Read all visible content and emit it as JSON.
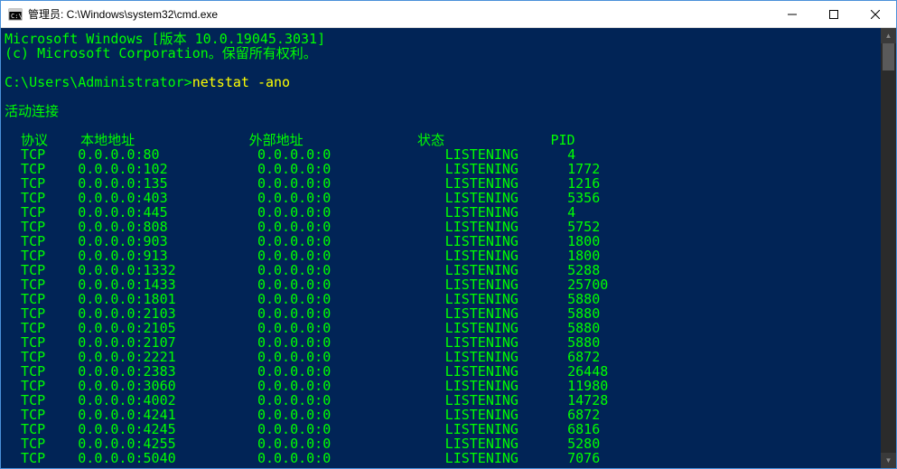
{
  "titlebar": {
    "text": "管理员: C:\\Windows\\system32\\cmd.exe"
  },
  "banner": {
    "line1": "Microsoft Windows [版本 10.0.19045.3031]",
    "line2": "(c) Microsoft Corporation。保留所有权利。"
  },
  "prompt": {
    "path": "C:\\Users\\Administrator>",
    "command": "netstat -ano"
  },
  "section_header": "活动连接",
  "columns": {
    "proto": "协议",
    "local": "本地地址",
    "foreign": "外部地址",
    "state": "状态",
    "pid": "PID"
  },
  "rows": [
    {
      "proto": "TCP",
      "local": "0.0.0.0:80",
      "foreign": "0.0.0.0:0",
      "state": "LISTENING",
      "pid": "4"
    },
    {
      "proto": "TCP",
      "local": "0.0.0.0:102",
      "foreign": "0.0.0.0:0",
      "state": "LISTENING",
      "pid": "1772"
    },
    {
      "proto": "TCP",
      "local": "0.0.0.0:135",
      "foreign": "0.0.0.0:0",
      "state": "LISTENING",
      "pid": "1216"
    },
    {
      "proto": "TCP",
      "local": "0.0.0.0:403",
      "foreign": "0.0.0.0:0",
      "state": "LISTENING",
      "pid": "5356"
    },
    {
      "proto": "TCP",
      "local": "0.0.0.0:445",
      "foreign": "0.0.0.0:0",
      "state": "LISTENING",
      "pid": "4"
    },
    {
      "proto": "TCP",
      "local": "0.0.0.0:808",
      "foreign": "0.0.0.0:0",
      "state": "LISTENING",
      "pid": "5752"
    },
    {
      "proto": "TCP",
      "local": "0.0.0.0:903",
      "foreign": "0.0.0.0:0",
      "state": "LISTENING",
      "pid": "1800"
    },
    {
      "proto": "TCP",
      "local": "0.0.0.0:913",
      "foreign": "0.0.0.0:0",
      "state": "LISTENING",
      "pid": "1800"
    },
    {
      "proto": "TCP",
      "local": "0.0.0.0:1332",
      "foreign": "0.0.0.0:0",
      "state": "LISTENING",
      "pid": "5288"
    },
    {
      "proto": "TCP",
      "local": "0.0.0.0:1433",
      "foreign": "0.0.0.0:0",
      "state": "LISTENING",
      "pid": "25700"
    },
    {
      "proto": "TCP",
      "local": "0.0.0.0:1801",
      "foreign": "0.0.0.0:0",
      "state": "LISTENING",
      "pid": "5880"
    },
    {
      "proto": "TCP",
      "local": "0.0.0.0:2103",
      "foreign": "0.0.0.0:0",
      "state": "LISTENING",
      "pid": "5880"
    },
    {
      "proto": "TCP",
      "local": "0.0.0.0:2105",
      "foreign": "0.0.0.0:0",
      "state": "LISTENING",
      "pid": "5880"
    },
    {
      "proto": "TCP",
      "local": "0.0.0.0:2107",
      "foreign": "0.0.0.0:0",
      "state": "LISTENING",
      "pid": "5880"
    },
    {
      "proto": "TCP",
      "local": "0.0.0.0:2221",
      "foreign": "0.0.0.0:0",
      "state": "LISTENING",
      "pid": "6872"
    },
    {
      "proto": "TCP",
      "local": "0.0.0.0:2383",
      "foreign": "0.0.0.0:0",
      "state": "LISTENING",
      "pid": "26448"
    },
    {
      "proto": "TCP",
      "local": "0.0.0.0:3060",
      "foreign": "0.0.0.0:0",
      "state": "LISTENING",
      "pid": "11980"
    },
    {
      "proto": "TCP",
      "local": "0.0.0.0:4002",
      "foreign": "0.0.0.0:0",
      "state": "LISTENING",
      "pid": "14728"
    },
    {
      "proto": "TCP",
      "local": "0.0.0.0:4241",
      "foreign": "0.0.0.0:0",
      "state": "LISTENING",
      "pid": "6872"
    },
    {
      "proto": "TCP",
      "local": "0.0.0.0:4245",
      "foreign": "0.0.0.0:0",
      "state": "LISTENING",
      "pid": "6816"
    },
    {
      "proto": "TCP",
      "local": "0.0.0.0:4255",
      "foreign": "0.0.0.0:0",
      "state": "LISTENING",
      "pid": "5280"
    },
    {
      "proto": "TCP",
      "local": "0.0.0.0:5040",
      "foreign": "0.0.0.0:0",
      "state": "LISTENING",
      "pid": "7076"
    }
  ]
}
